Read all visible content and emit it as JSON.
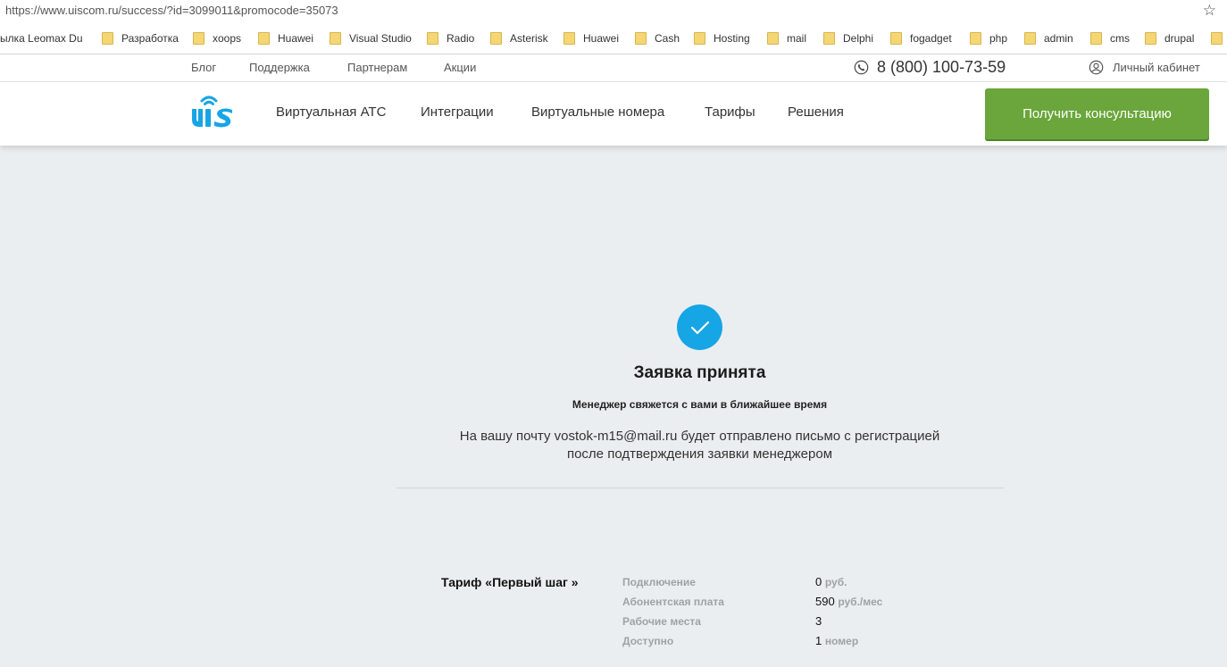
{
  "browser": {
    "url": "https://www.uiscom.ru/success/?id=3099011&promocode=35073"
  },
  "bookmarks": [
    "ылка Leomax Du",
    "Разработка",
    "xoops",
    "Huawei",
    "Visual Studio",
    "Radio",
    "Asterisk",
    "Huawei",
    "Cash",
    "Hosting",
    "mail",
    "Delphi",
    "fogadget",
    "php",
    "admin",
    "cms",
    "drupal"
  ],
  "top_links": {
    "blog": "Блог",
    "support": "Поддержка",
    "partners": "Партнерам",
    "promo": "Акции",
    "phone": "8 (800) 100-73-59",
    "cabinet": "Личный кабинет"
  },
  "nav": {
    "items": [
      "Виртуальная АТС",
      "Интеграции",
      "Виртуальные номера",
      "Тарифы",
      "Решения"
    ],
    "cta": "Получить консультацию"
  },
  "success": {
    "title": "Заявка принята",
    "subtitle": "Менеджер свяжется с вами в ближайшее время",
    "desc_line1": "На вашу почту vostok-m15@mail.ru будет отправлено письмо с регистрацией",
    "desc_line2": "после подтверждения заявки менеджером"
  },
  "tariff": {
    "name": "Тариф «Первый шаг »",
    "rows": [
      {
        "label": "Подключение",
        "value": "0",
        "unit": "руб."
      },
      {
        "label": "Абонентская плата",
        "value": "590",
        "unit": "руб./мес"
      },
      {
        "label": "Рабочие места",
        "value": "3",
        "unit": ""
      },
      {
        "label": "Доступно",
        "value": "1",
        "unit": "номер"
      }
    ]
  },
  "colors": {
    "accent_blue": "#16a5e5",
    "cta_green": "#6aa63b",
    "background": "#ebeef0"
  }
}
